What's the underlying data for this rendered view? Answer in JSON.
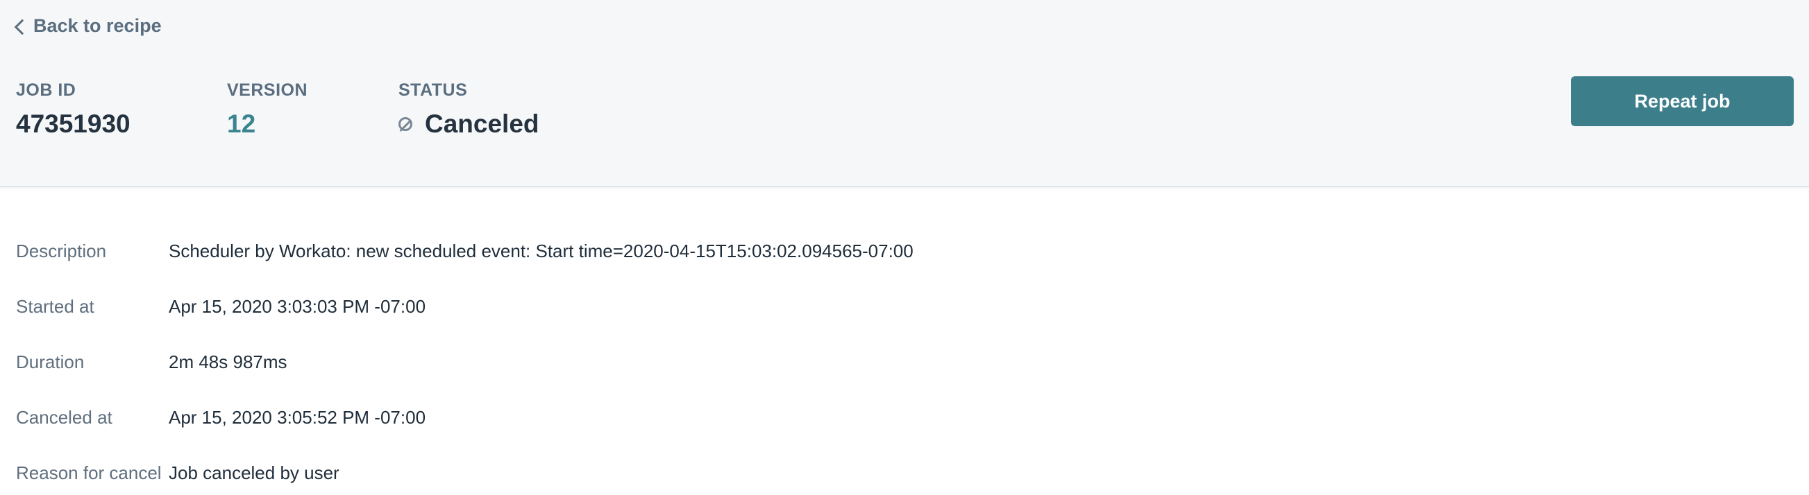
{
  "nav": {
    "back_label": "Back to recipe"
  },
  "job": {
    "id_label": "JOB ID",
    "id_value": "47351930",
    "version_label": "VERSION",
    "version_value": "12",
    "status_label": "STATUS",
    "status_value": "Canceled",
    "status_icon": "cancel-circle-icon"
  },
  "actions": {
    "repeat_label": "Repeat job"
  },
  "details": [
    {
      "label": "Description",
      "value": "Scheduler by Workato: new scheduled event: Start time=2020-04-15T15:03:02.094565-07:00"
    },
    {
      "label": "Started at",
      "value": "Apr 15, 2020 3:03:03 PM -07:00"
    },
    {
      "label": "Duration",
      "value": "2m 48s 987ms"
    },
    {
      "label": "Canceled at",
      "value": "Apr 15, 2020 3:05:52 PM -07:00"
    },
    {
      "label": "Reason for cancel",
      "value": "Job canceled by user"
    }
  ],
  "colors": {
    "accent": "#3c7f8b",
    "link": "#3a8590",
    "header_bg": "#f6f7f8"
  }
}
